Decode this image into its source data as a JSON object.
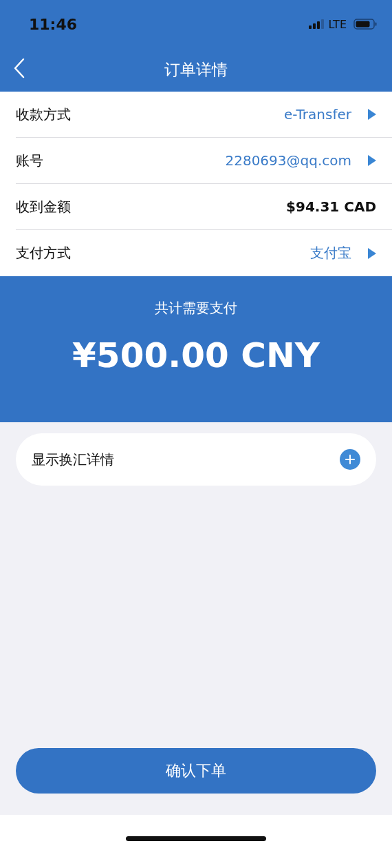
{
  "status_bar": {
    "time": "11:46",
    "network": "LTE"
  },
  "nav": {
    "title": "订单详情"
  },
  "rows": [
    {
      "label": "收款方式",
      "value": "e-Transfer",
      "kind": "link"
    },
    {
      "label": "账号",
      "value": "2280693@qq.com",
      "kind": "link"
    },
    {
      "label": "收到金额",
      "value": "$94.31 CAD",
      "kind": "plain"
    },
    {
      "label": "支付方式",
      "value": "支付宝",
      "kind": "link"
    }
  ],
  "total": {
    "label": "共计需要支付",
    "amount": "¥500.00 CNY"
  },
  "exchange_details": {
    "label": "显示换汇详情",
    "expanded": false
  },
  "confirm_button": "确认下单"
}
